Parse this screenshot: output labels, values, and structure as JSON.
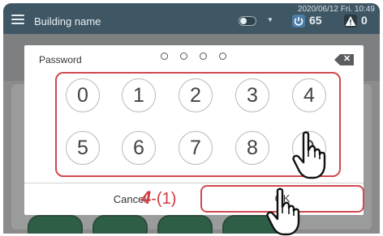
{
  "header": {
    "title": "Building name",
    "datetime": "2020/06/12 Fri. 10:49",
    "power_count": "65",
    "alert_count": "0"
  },
  "dialog": {
    "password_label": "Password",
    "keys": [
      "0",
      "1",
      "2",
      "3",
      "4",
      "5",
      "6",
      "7",
      "8",
      "9"
    ],
    "cancel_label": "Cancel",
    "ok_label": "OK"
  },
  "annotation": {
    "step_number": "4",
    "step_suffix": "-(1)"
  },
  "colors": {
    "header_bg": "#3f5764",
    "highlight": "#d04a4f",
    "accent_green": "#2e5f46"
  }
}
